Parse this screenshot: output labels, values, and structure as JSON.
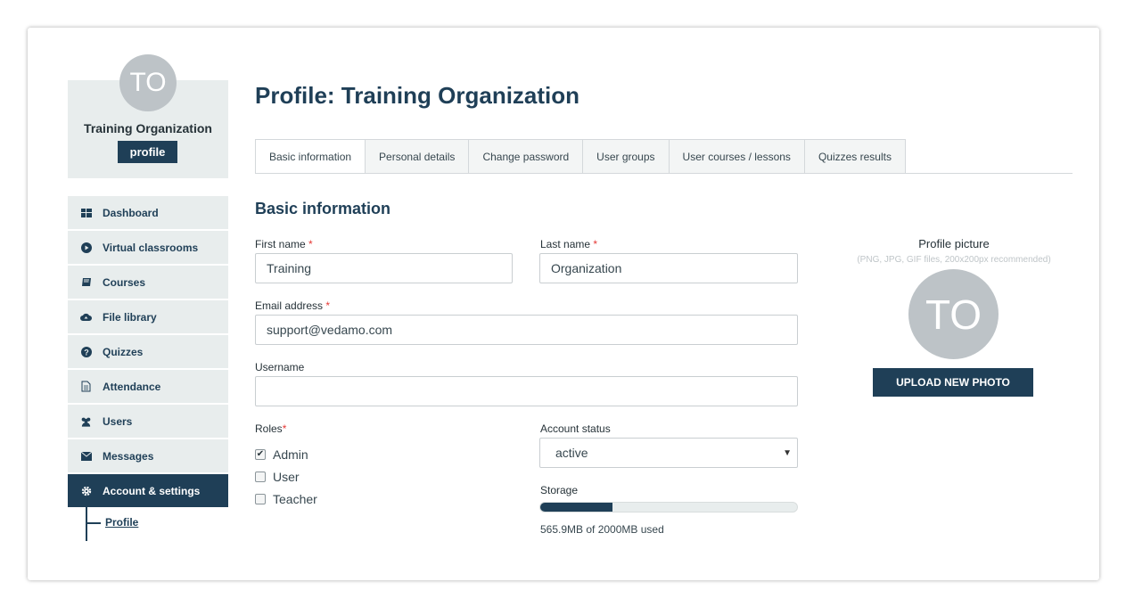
{
  "sidebar": {
    "avatar_initials": "TO",
    "org_name": "Training Organization",
    "profile_tag": "profile",
    "items": [
      {
        "label": "Dashboard",
        "icon": "dashboard-icon"
      },
      {
        "label": "Virtual classrooms",
        "icon": "play-circle-icon"
      },
      {
        "label": "Courses",
        "icon": "book-icon"
      },
      {
        "label": "File library",
        "icon": "cloud-upload-icon"
      },
      {
        "label": "Quizzes",
        "icon": "question-circle-icon"
      },
      {
        "label": "Attendance",
        "icon": "document-icon"
      },
      {
        "label": "Users",
        "icon": "users-icon"
      },
      {
        "label": "Messages",
        "icon": "envelope-icon"
      },
      {
        "label": "Account & settings",
        "icon": "gear-icon",
        "active": true
      }
    ],
    "sub_item": "Profile"
  },
  "main": {
    "title": "Profile: Training Organization",
    "tabs": [
      "Basic information",
      "Personal details",
      "Change password",
      "User groups",
      "User courses / lessons",
      "Quizzes results"
    ],
    "section_title": "Basic information",
    "form": {
      "first_name_label": "First name",
      "first_name_value": "Training",
      "last_name_label": "Last name",
      "last_name_value": "Organization",
      "email_label": "Email address",
      "email_value": "support@vedamo.com",
      "username_label": "Username",
      "username_value": "",
      "required_mark": "*",
      "roles_label": "Roles",
      "roles": [
        {
          "label": "Admin",
          "checked": true
        },
        {
          "label": "User",
          "checked": false
        },
        {
          "label": "Teacher",
          "checked": false
        }
      ],
      "account_status_label": "Account status",
      "account_status_value": "active",
      "storage_label": "Storage",
      "storage_used_fraction": 0.282,
      "storage_text": "565.9MB of 2000MB used"
    },
    "picture": {
      "title": "Profile picture",
      "hint": "(PNG, JPG, GIF files, 200x200px recommended)",
      "initials": "TO",
      "upload_label": "UPLOAD NEW PHOTO"
    }
  },
  "colors": {
    "primary": "#1f3f57",
    "required": "#e53935",
    "sidebar_bg": "#e8eded"
  }
}
